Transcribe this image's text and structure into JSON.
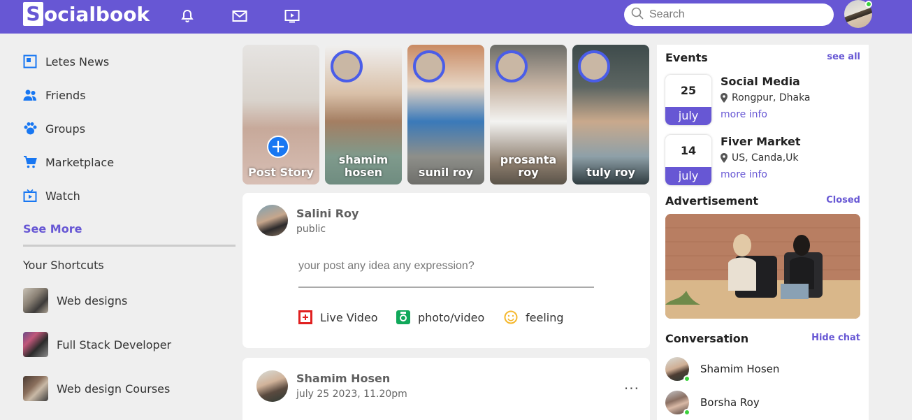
{
  "brand": {
    "logo_letter": "S",
    "logo_text": "ocialbook",
    "accent": "#6757d4"
  },
  "nav": {
    "icons": [
      "bell-icon",
      "mail-icon",
      "video-icon"
    ],
    "search_placeholder": "Search"
  },
  "sidebar": {
    "items": [
      {
        "label": "Letes News",
        "icon": "news-icon"
      },
      {
        "label": "Friends",
        "icon": "friends-icon"
      },
      {
        "label": "Groups",
        "icon": "groups-icon"
      },
      {
        "label": "Marketplace",
        "icon": "cart-icon"
      },
      {
        "label": "Watch",
        "icon": "tv-icon"
      }
    ],
    "see_more": "See More",
    "shortcuts_title": "Your Shortcuts",
    "shortcuts": [
      {
        "label": "Web designs"
      },
      {
        "label": "Full Stack Developer"
      },
      {
        "label": "Web design Courses"
      }
    ]
  },
  "stories": [
    {
      "label": "Post Story"
    },
    {
      "label": "shamim hosen"
    },
    {
      "label": "sunil roy"
    },
    {
      "label": "prosanta roy"
    },
    {
      "label": "tuly roy"
    }
  ],
  "composer": {
    "name": "Salini Roy",
    "visibility": "public",
    "placeholder": "your post any idea any expression?",
    "actions": [
      {
        "label": "Live Video",
        "icon": "live-video-icon",
        "color": "#e02020"
      },
      {
        "label": "photo/video",
        "icon": "camera-icon",
        "color": "#10a85a"
      },
      {
        "label": "feeling",
        "icon": "smiley-icon",
        "color": "#f5b82e"
      }
    ]
  },
  "post": {
    "name": "Shamim Hosen",
    "date": "july 25 2023, 11.20pm",
    "menu": "..."
  },
  "events": {
    "title": "Events",
    "see_all": "see all",
    "items": [
      {
        "day": "25",
        "month": "july",
        "title": "Social Media",
        "location": "Rongpur, Dhaka",
        "more": "more info"
      },
      {
        "day": "14",
        "month": "july",
        "title": "Fiver Market",
        "location": "US, Canda,Uk",
        "more": "more info"
      }
    ]
  },
  "advertisement": {
    "title": "Advertisement",
    "close": "Closed"
  },
  "conversation": {
    "title": "Conversation",
    "hide": "Hide chat",
    "items": [
      {
        "name": "Shamim Hosen"
      },
      {
        "name": "Borsha Roy"
      }
    ]
  }
}
